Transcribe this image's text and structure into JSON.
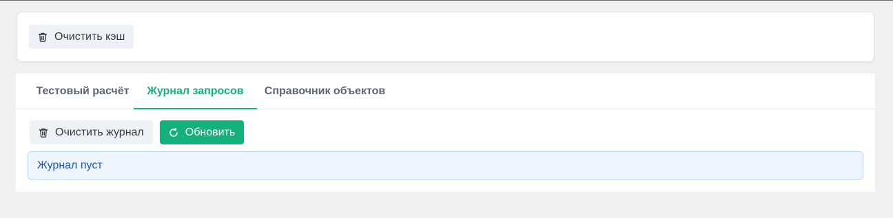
{
  "cache": {
    "clear_cache_label": "Очистить кэш",
    "icon": "trash-icon"
  },
  "tabs": [
    {
      "label": "Тестовый расчёт",
      "active": false
    },
    {
      "label": "Журнал запросов",
      "active": true
    },
    {
      "label": "Справочник объектов",
      "active": false
    }
  ],
  "journal": {
    "clear_journal_label": "Очистить журнал",
    "refresh_label": "Обновить",
    "empty_message": "Журнал пуст"
  },
  "colors": {
    "accent": "#14b27a",
    "info_text": "#1f57ba",
    "info_bg": "#eef5fe",
    "info_border": "#b6d4f3",
    "page_bg": "#f0f0f0"
  }
}
